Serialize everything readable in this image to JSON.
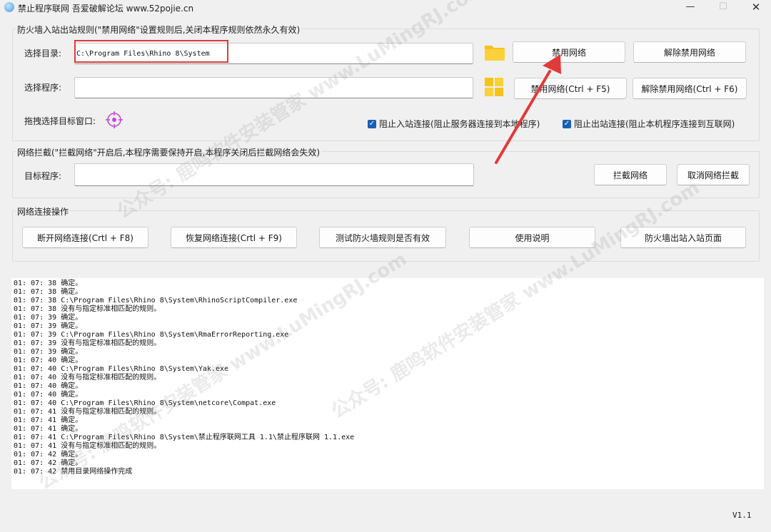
{
  "window": {
    "title": "禁止程序联网 吾爱破解论坛 www.52pojie.cn",
    "minimize_glyph": "—",
    "maximize_glyph": "☐",
    "close_glyph": "✕"
  },
  "firewall_group": {
    "title": "防火墙入站出站规则(\"禁用网络\"设置规则后,关闭本程序规则依然永久有效)",
    "select_dir_label": "选择目录:",
    "select_dir_value": "C:\\Program Files\\Rhino 8\\System",
    "select_prog_label": "选择程序:",
    "select_prog_value": "",
    "btn_disable_network": "禁用网络",
    "btn_enable_network": "解除禁用网络",
    "btn_disable_network_hotkey": "禁用网络(Ctrl + F5)",
    "btn_enable_network_hotkey": "解除禁用网络(Ctrl + F6)",
    "drag_window_label": "拖拽选择目标窗口:",
    "chk_block_inbound": "阻止入站连接(阻止服务器连接到本地程序)",
    "chk_block_outbound": "阻止出站连接(阻止本机程序连接到互联网)"
  },
  "intercept_group": {
    "title": "网络拦截(\"拦截网络\"开启后,本程序需要保持开启,本程序关闭后拦截网络会失效)",
    "target_label": "目标程序:",
    "target_value": "",
    "btn_intercept": "拦截网络",
    "btn_cancel_intercept": "取消网络拦截"
  },
  "ops_group": {
    "title": "网络连接操作",
    "btn_disconnect": "断开网络连接(Crtl + F8)",
    "btn_restore": "恢复网络连接(Crtl + F9)",
    "btn_test_rules": "测试防火墙规则是否有效",
    "btn_help": "使用说明",
    "btn_firewall_page": "防火墙出站入站页面"
  },
  "log": [
    "01: 07: 38 确定。",
    "01: 07: 38 确定。",
    "01: 07: 38 C:\\Program Files\\Rhino 8\\System\\RhinoScriptCompiler.exe",
    "01: 07: 38 没有与指定标准相匹配的规则。",
    "01: 07: 39 确定。",
    "01: 07: 39 确定。",
    "01: 07: 39 C:\\Program Files\\Rhino 8\\System\\RmaErrorReporting.exe",
    "01: 07: 39 没有与指定标准相匹配的规则。",
    "01: 07: 39 确定。",
    "01: 07: 40 确定。",
    "01: 07: 40 C:\\Program Files\\Rhino 8\\System\\Yak.exe",
    "01: 07: 40 没有与指定标准相匹配的规则。",
    "01: 07: 40 确定。",
    "01: 07: 40 确定。",
    "01: 07: 40 C:\\Program Files\\Rhino 8\\System\\netcore\\Compat.exe",
    "01: 07: 41 没有与指定标准相匹配的规则。",
    "01: 07: 41 确定。",
    "01: 07: 41 确定。",
    "01: 07: 41 C:\\Program Files\\Rhino 8\\System\\禁止程序联网工具 1.1\\禁止程序联网 1.1.exe",
    "01: 07: 41 没有与指定标准相匹配的规则。",
    "01: 07: 42 确定。",
    "01: 07: 42 确定。",
    "01: 07: 42 禁用目录网络操作完成"
  ],
  "version": "V1.1",
  "watermark_text": "公众号: 鹿鸣软件安装管家 www.LuMingRJ.com",
  "colors": {
    "highlight_box": "#e03a3a",
    "arrow": "#e03a3a",
    "checkbox": "#1a5fb4",
    "folder_icon": "#f7c21b"
  }
}
